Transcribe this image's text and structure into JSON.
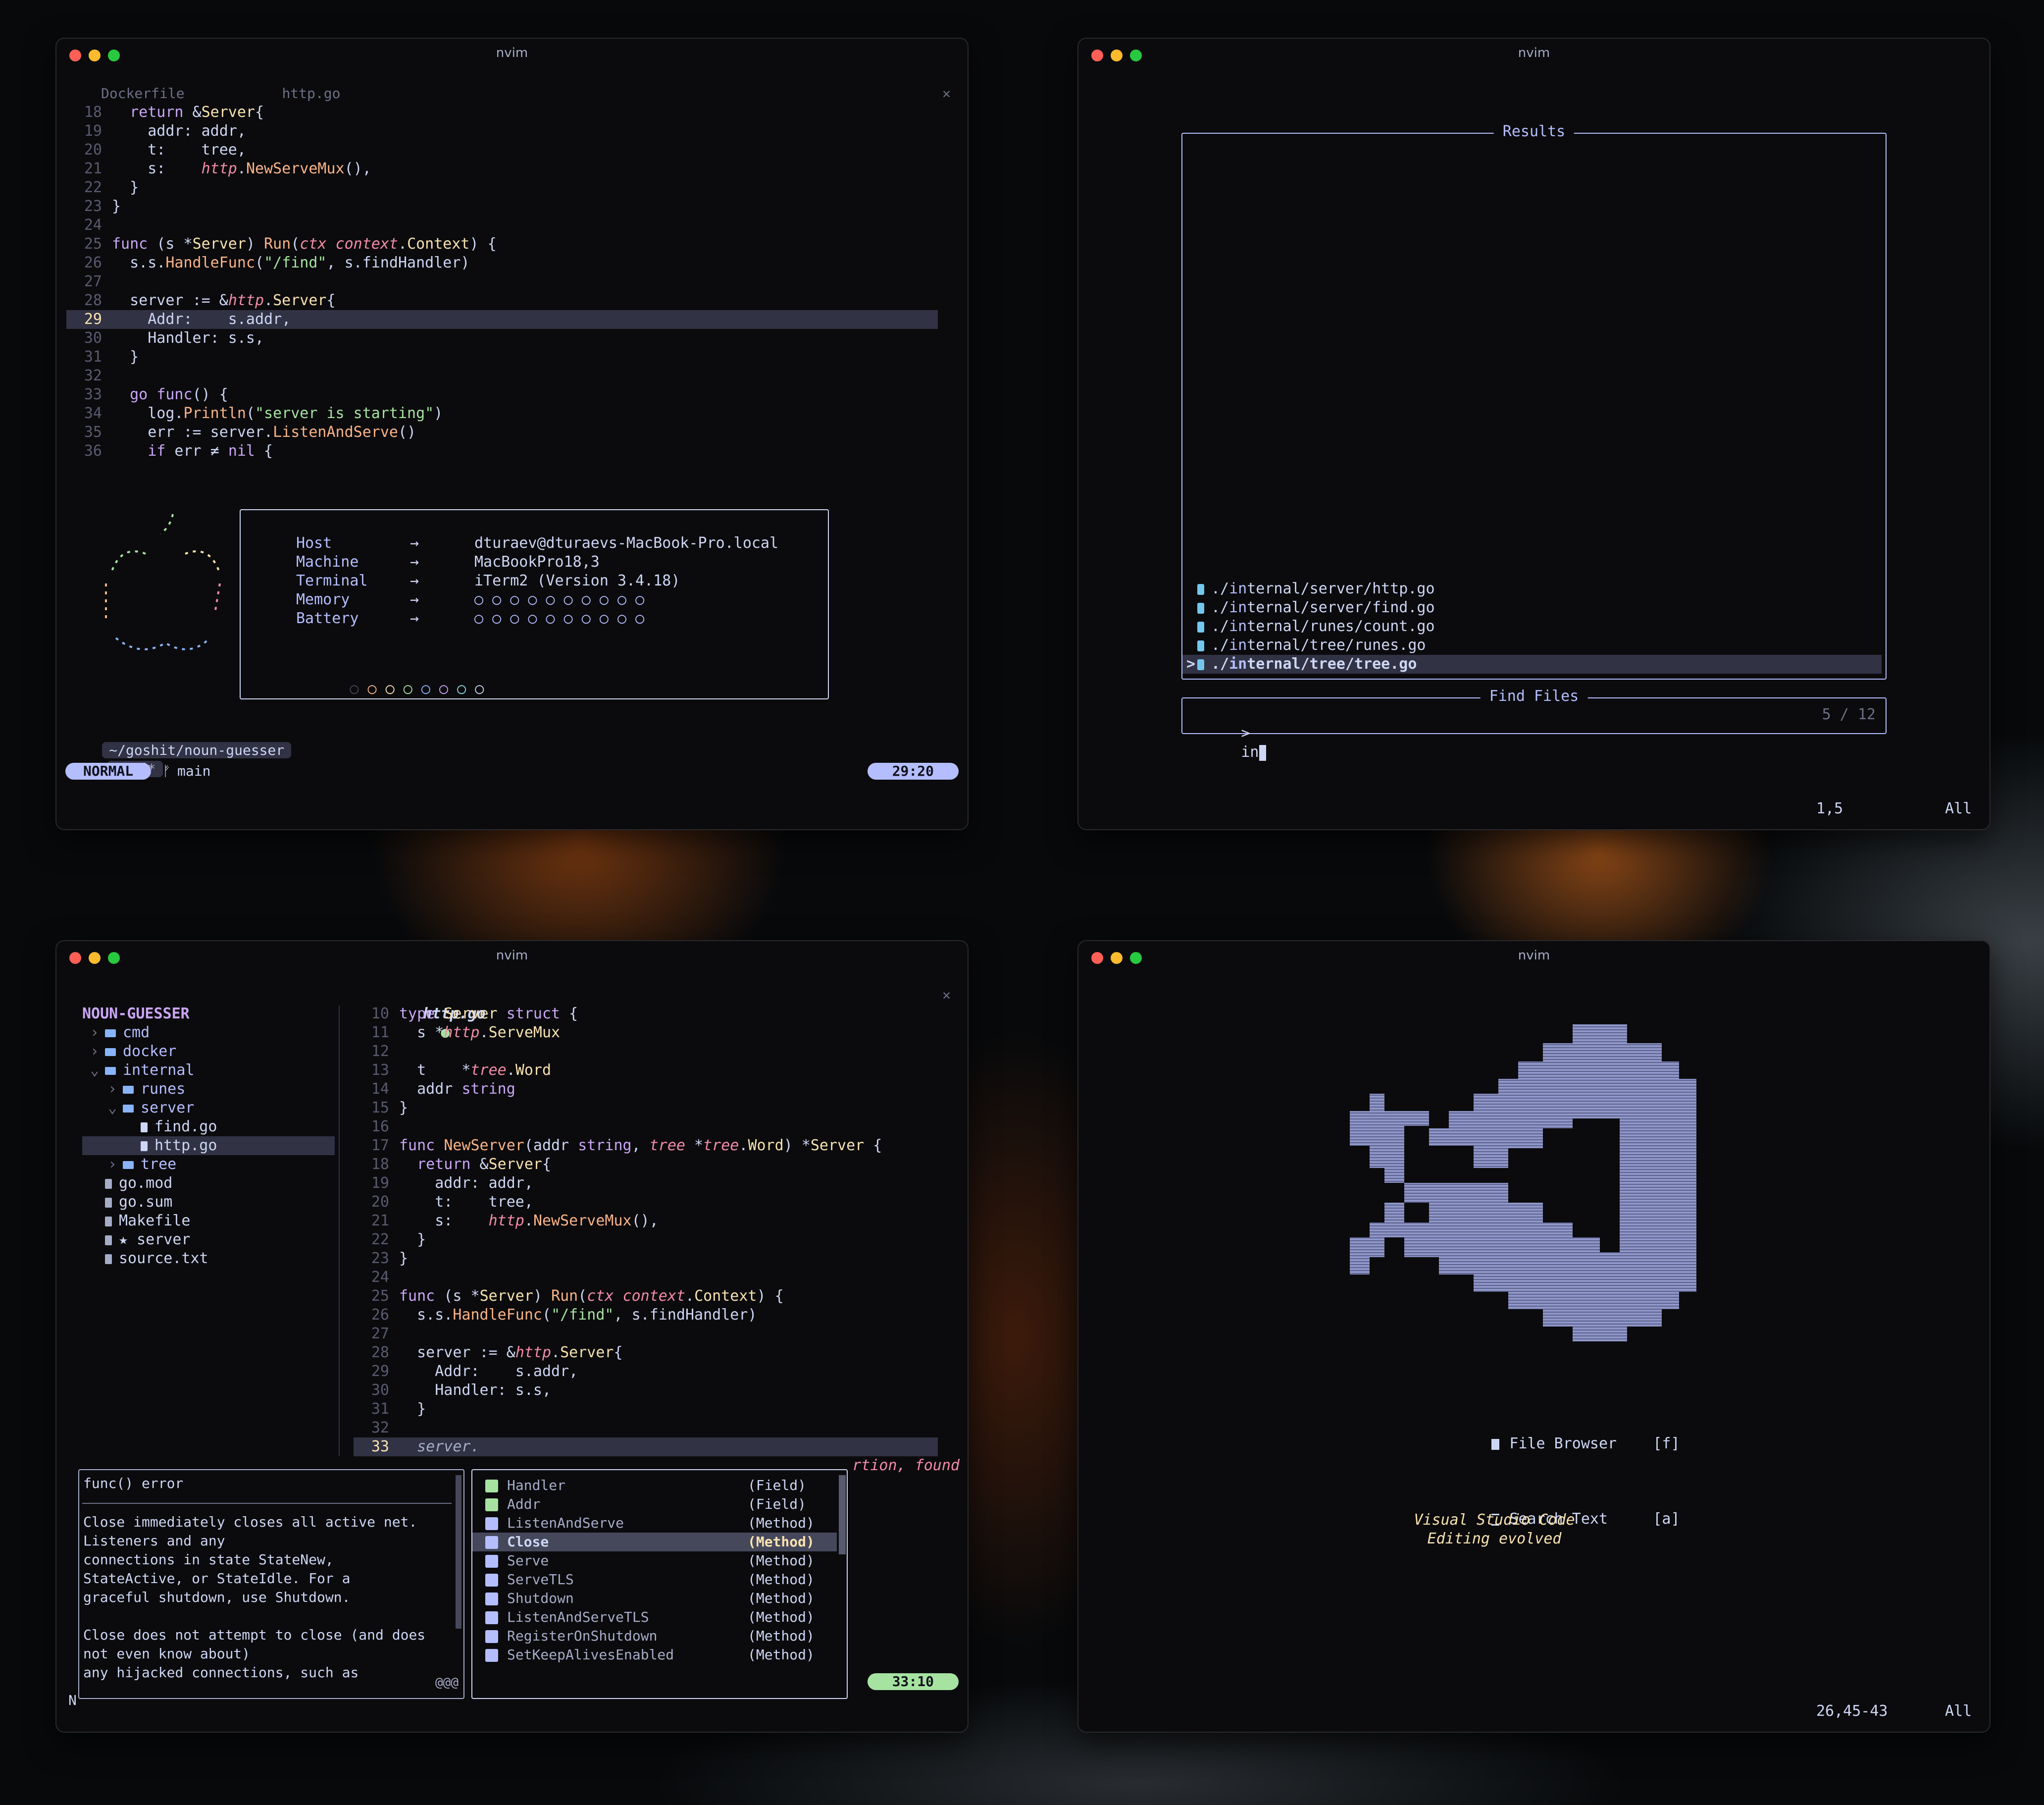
{
  "windows": {
    "tl": {
      "title": "nvim",
      "tabs": [
        "Dockerfile",
        "http.go"
      ],
      "code": [
        {
          "n": "18",
          "t": "  return &Server{"
        },
        {
          "n": "19",
          "t": "    addr: addr,"
        },
        {
          "n": "20",
          "t": "    t:    tree,"
        },
        {
          "n": "21",
          "t": "    s:    http.NewServeMux(),"
        },
        {
          "n": "22",
          "t": "  }"
        },
        {
          "n": "23",
          "t": "}"
        },
        {
          "n": "24",
          "t": ""
        },
        {
          "n": "25",
          "t": "func (s *Server) Run(ctx context.Context) {"
        },
        {
          "n": "26",
          "t": "  s.s.HandleFunc(\"/find\", s.findHandler)"
        },
        {
          "n": "27",
          "t": ""
        },
        {
          "n": "28",
          "t": "  server := &http.Server{"
        },
        {
          "n": "29",
          "t": "    Addr:    s.addr,"
        },
        {
          "n": "30",
          "t": "    Handler: s.s,"
        },
        {
          "n": "31",
          "t": "  }"
        },
        {
          "n": "32",
          "t": ""
        },
        {
          "n": "33",
          "t": "  go func() {"
        },
        {
          "n": "34",
          "t": "    log.Println(\"server is starting\")"
        },
        {
          "n": "35",
          "t": "    err := server.ListenAndServe()"
        },
        {
          "n": "36",
          "t": "    if err ≠ nil {"
        }
      ],
      "fetch": {
        "rows": [
          {
            "k": "Host",
            "a": "→",
            "v": "dturaev@dturaevs-MacBook-Pro.local"
          },
          {
            "k": "Machine",
            "a": "→",
            "v": "MacBookPro18,3"
          },
          {
            "k": "Terminal",
            "a": "→",
            "v": "iTerm2 (Version 3.4.18)"
          },
          {
            "k": "Memory",
            "a": "→",
            "v": "○ ○ ○ ○ ○ ○ ○ ○ ○ ○"
          },
          {
            "k": "Battery",
            "a": "→",
            "v": "○ ○ ○ ○ ○ ○ ○ ○ ○ ○"
          }
        ],
        "palette": "○ ○ ○ ○ ○ ○ ○ ○"
      },
      "prompt_path": "~/goshit/noun-guesser",
      "prompt_branch": "main*",
      "prompt_arrow": "→",
      "mode": "NORMAL",
      "branch": "main",
      "position": "29:20"
    },
    "tr": {
      "title": "nvim",
      "results_title": "Results",
      "results": [
        "./internal/server/http.go",
        "./internal/server/find.go",
        "./internal/runes/count.go",
        "./internal/tree/runes.go",
        "./internal/tree/tree.go"
      ],
      "find_title": "Find Files",
      "query": "in",
      "prompt": ">",
      "count": "5 / 12",
      "ruler": "1,5",
      "scroll": "All"
    },
    "bl": {
      "title": "nvim",
      "tree_root": "NOUN-GUESSER",
      "tree": [
        {
          "name": "cmd",
          "kind": "folder",
          "depth": 0,
          "arrow": "›"
        },
        {
          "name": "docker",
          "kind": "folder",
          "depth": 0,
          "arrow": "›"
        },
        {
          "name": "internal",
          "kind": "folder",
          "depth": 0,
          "arrow": "⌄"
        },
        {
          "name": "runes",
          "kind": "folder",
          "depth": 1,
          "arrow": "›"
        },
        {
          "name": "server",
          "kind": "folder",
          "depth": 1,
          "arrow": "⌄"
        },
        {
          "name": "find.go",
          "kind": "file",
          "depth": 2,
          "arrow": ""
        },
        {
          "name": "http.go",
          "kind": "file",
          "depth": 2,
          "arrow": ""
        },
        {
          "name": "tree",
          "kind": "folder",
          "depth": 1,
          "arrow": "›"
        },
        {
          "name": "go.mod",
          "kind": "doc",
          "depth": 0,
          "arrow": ""
        },
        {
          "name": "go.sum",
          "kind": "doc",
          "depth": 0,
          "arrow": ""
        },
        {
          "name": "Makefile",
          "kind": "doc",
          "depth": 0,
          "arrow": ""
        },
        {
          "name": "★ server",
          "kind": "doc",
          "depth": 0,
          "arrow": ""
        },
        {
          "name": "source.txt",
          "kind": "doc",
          "depth": 0,
          "arrow": ""
        }
      ],
      "tab": "http.go",
      "tab_mark": "●",
      "code": [
        {
          "n": "10",
          "t": "type Server struct {"
        },
        {
          "n": "11",
          "t": "  s *http.ServeMux"
        },
        {
          "n": "12",
          "t": ""
        },
        {
          "n": "13",
          "t": "  t    *tree.Word"
        },
        {
          "n": "14",
          "t": "  addr string"
        },
        {
          "n": "15",
          "t": "}"
        },
        {
          "n": "16",
          "t": ""
        },
        {
          "n": "17",
          "t": "func NewServer(addr string, tree *tree.Word) *Server {"
        },
        {
          "n": "18",
          "t": "  return &Server{"
        },
        {
          "n": "19",
          "t": "    addr: addr,"
        },
        {
          "n": "20",
          "t": "    t:    tree,"
        },
        {
          "n": "21",
          "t": "    s:    http.NewServeMux(),"
        },
        {
          "n": "22",
          "t": "  }"
        },
        {
          "n": "23",
          "t": "}"
        },
        {
          "n": "24",
          "t": ""
        },
        {
          "n": "25",
          "t": "func (s *Server) Run(ctx context.Context) {"
        },
        {
          "n": "26",
          "t": "  s.s.HandleFunc(\"/find\", s.findHandler)"
        },
        {
          "n": "27",
          "t": ""
        },
        {
          "n": "28",
          "t": "  server := &http.Server{"
        },
        {
          "n": "29",
          "t": "    Addr:    s.addr,"
        },
        {
          "n": "30",
          "t": "    Handler: s.s,"
        },
        {
          "n": "31",
          "t": "  }"
        },
        {
          "n": "32",
          "t": ""
        },
        {
          "n": "33",
          "t": "  server."
        }
      ],
      "virtual_text": "rtion, found",
      "doc": {
        "signature": "func() error",
        "body": "Close immediately closes all active net.\nListeners and any\nconnections in state StateNew,\nStateActive, or StateIdle. For a\ngraceful shutdown, use Shutdown.\n\nClose does not attempt to close (and does\nnot even know about)\nany hijacked connections, such as",
        "more": "@@@"
      },
      "completions": [
        {
          "label": "Handler",
          "kind": "(Field)"
        },
        {
          "label": "Addr",
          "kind": "(Field)"
        },
        {
          "label": "ListenAndServe",
          "kind": "(Method)"
        },
        {
          "label": "Close",
          "kind": "(Method)"
        },
        {
          "label": "Serve",
          "kind": "(Method)"
        },
        {
          "label": "ServeTLS",
          "kind": "(Method)"
        },
        {
          "label": "Shutdown",
          "kind": "(Method)"
        },
        {
          "label": "ListenAndServeTLS",
          "kind": "(Method)"
        },
        {
          "label": "RegisterOnShutdown",
          "kind": "(Method)"
        },
        {
          "label": "SetKeepAlivesEnabled",
          "kind": "(Method)"
        }
      ],
      "mode_short": "N",
      "position": "33:10"
    },
    "br": {
      "title": "nvim",
      "menu": [
        {
          "label": "File Browser",
          "key": "[f]"
        },
        {
          "label": "Search Text",
          "key": "[a]"
        }
      ],
      "tagline1": "Visual Studio Code",
      "tagline2": "Editing evolved",
      "ruler": "26,45-43",
      "scroll": "All"
    }
  },
  "colors": {
    "accent": "#b4befe",
    "green": "#a6e3a1",
    "peach": "#fab387",
    "mauve": "#cba6f7"
  }
}
